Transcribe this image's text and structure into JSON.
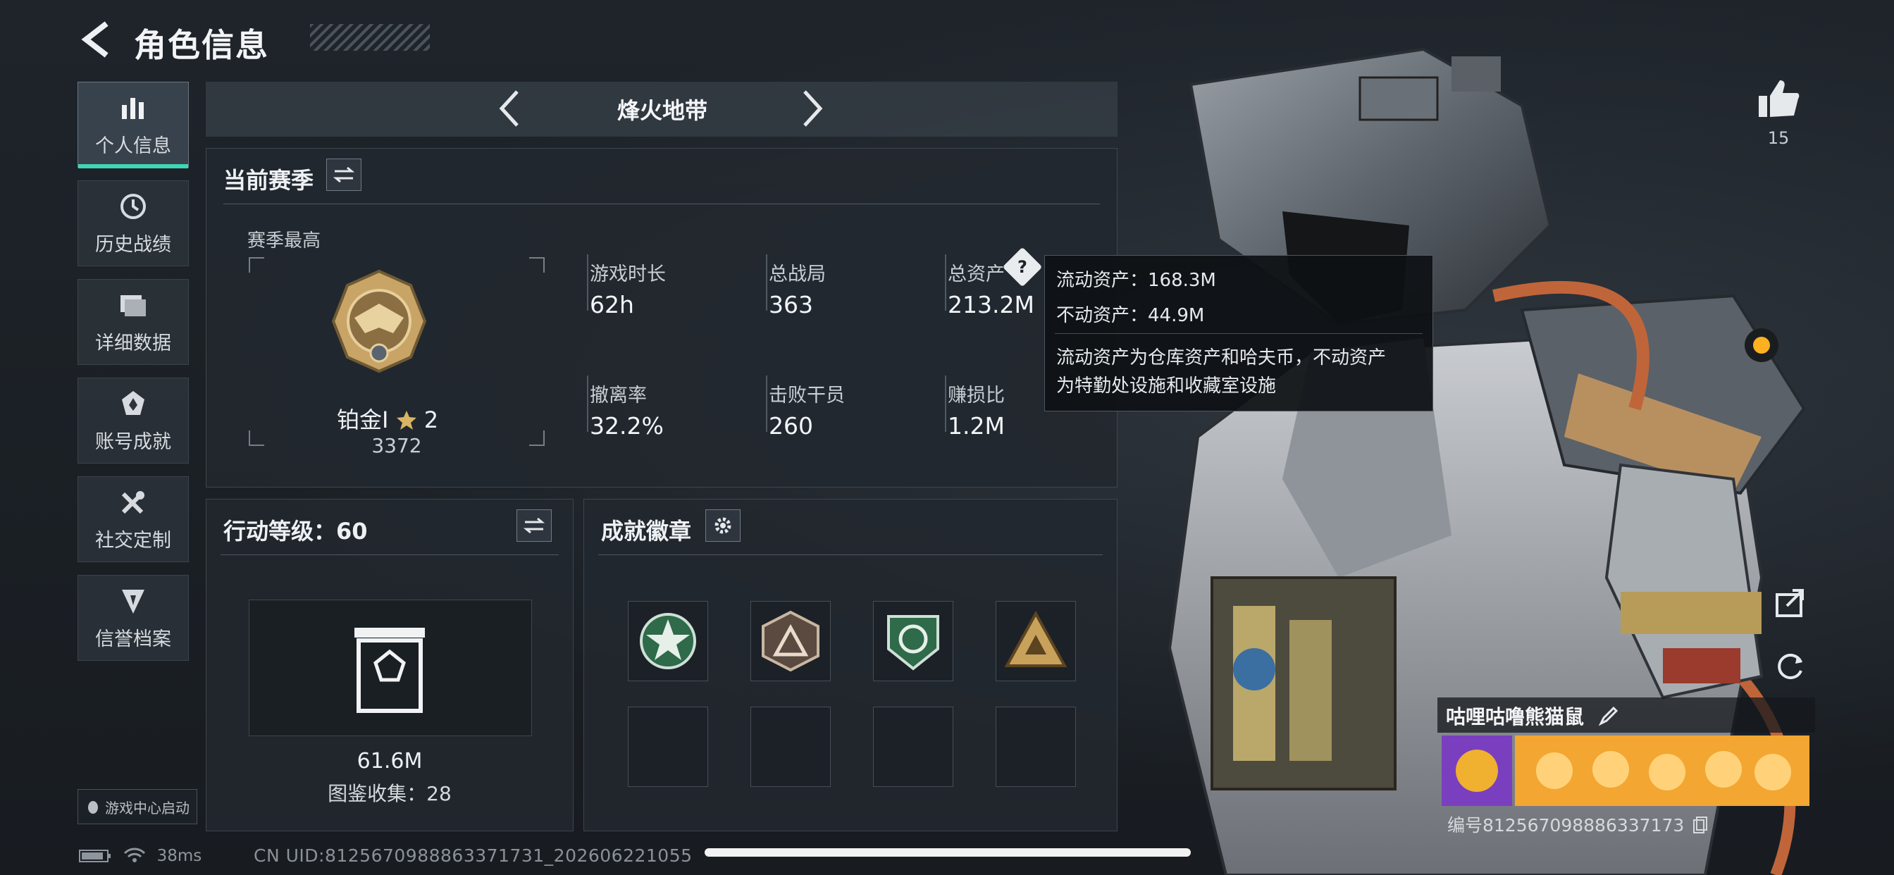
{
  "header": {
    "title": "角色信息"
  },
  "sidebar": {
    "items": [
      {
        "label": "个人信息",
        "icon": "bar-chart-icon",
        "active": true
      },
      {
        "label": "历史战绩",
        "icon": "history-clock-icon"
      },
      {
        "label": "详细数据",
        "icon": "folder-icon"
      },
      {
        "label": "账号成就",
        "icon": "achievement-badge-icon"
      },
      {
        "label": "社交定制",
        "icon": "wrench-tools-icon"
      },
      {
        "label": "信誉档案",
        "icon": "credit-shield-icon"
      }
    ],
    "game_center": "游戏中心启动"
  },
  "mode": {
    "title": "烽火地带"
  },
  "season": {
    "title": "当前赛季",
    "best_label": "赛季最高",
    "rank_name": "铂金Ⅰ",
    "rank_stars": "2",
    "rank_score": "3372",
    "stats": [
      {
        "label": "游戏时长",
        "value": "62h"
      },
      {
        "label": "总战局",
        "value": "363"
      },
      {
        "label": "总资产",
        "value": "213.2M"
      },
      {
        "label": "撤离率",
        "value": "32.2%"
      },
      {
        "label": "击败干员",
        "value": "260"
      },
      {
        "label": "赚损比",
        "value": "1.2M"
      }
    ]
  },
  "tooltip": {
    "line1": "流动资产：168.3M",
    "line2": "不动资产：44.9M",
    "desc1": "流动资产为仓库资产和哈夫币，不动资产",
    "desc2": "为特勤处设施和收藏室设施"
  },
  "action": {
    "title": "行动等级：60",
    "value": "61.6M",
    "collection": "图鉴收集：28"
  },
  "achievements": {
    "title": "成就徽章",
    "badges": [
      "green-star-badge-icon",
      "triangle-rank-badge-icon",
      "green-cycle-badge-icon",
      "gold-triangle-badge-icon"
    ]
  },
  "profile": {
    "likes": "15",
    "name": "咕哩咕噜熊猫鼠",
    "uid": "编号812567098886337173"
  },
  "status_bar": {
    "ping": "38ms",
    "uid_line": "CN UID:8125670988863371731_202606221055"
  },
  "colors": {
    "accent": "#3ed6b4",
    "panel": "#22282f",
    "gold": "#c8a25a"
  }
}
